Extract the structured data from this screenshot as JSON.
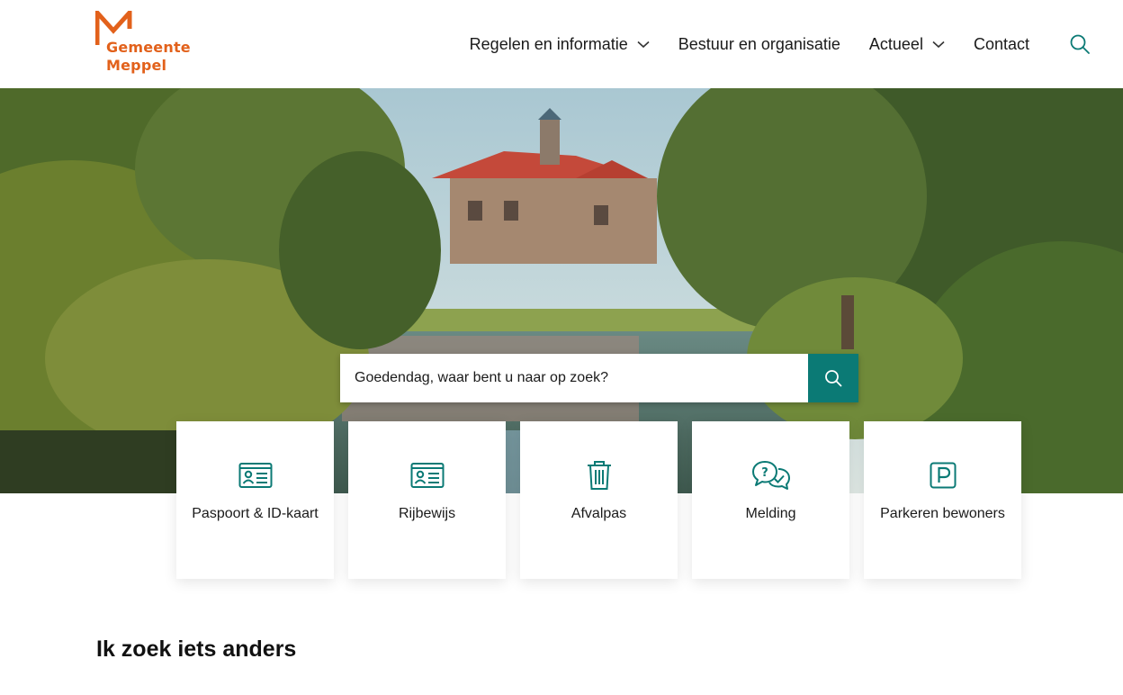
{
  "brand": {
    "name_line1": "Gemeente",
    "name_line2": "Meppel",
    "logo_color": "#e2611b"
  },
  "nav": {
    "items": [
      {
        "label": "Regelen en informatie",
        "has_dropdown": true
      },
      {
        "label": "Bestuur en organisatie",
        "has_dropdown": false
      },
      {
        "label": "Actueel",
        "has_dropdown": true
      },
      {
        "label": "Contact",
        "has_dropdown": false
      }
    ],
    "search_icon": "search-icon"
  },
  "hero": {
    "search_placeholder": "Goedendag, waar bent u naar op zoek?",
    "search_button_icon": "search-icon",
    "accent_color": "#0b7a75"
  },
  "tiles": [
    {
      "label": "Paspoort & ID-kaart",
      "icon": "id-card-icon"
    },
    {
      "label": "Rijbewijs",
      "icon": "id-card-icon"
    },
    {
      "label": "Afvalpas",
      "icon": "trash-icon"
    },
    {
      "label": "Melding",
      "icon": "chat-question-icon"
    },
    {
      "label": "Parkeren bewoners",
      "icon": "parking-icon"
    }
  ],
  "section": {
    "title": "Ik zoek iets anders"
  }
}
